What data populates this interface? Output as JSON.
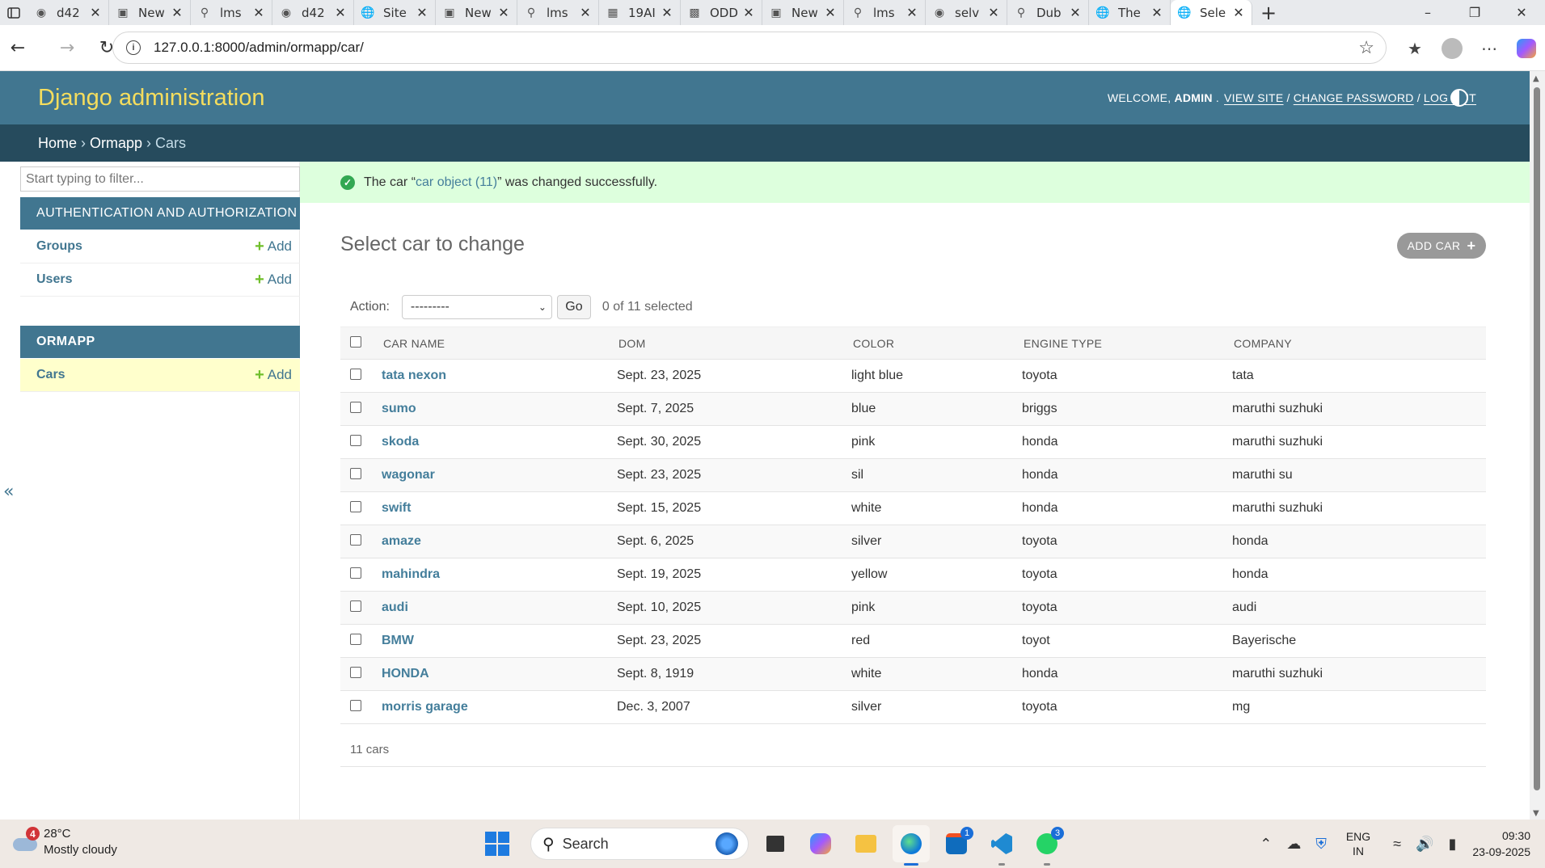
{
  "browser": {
    "tabs": [
      {
        "title": "d42",
        "icon": "github-icon"
      },
      {
        "title": "New",
        "icon": "page-icon"
      },
      {
        "title": "lms",
        "icon": "search-icon"
      },
      {
        "title": "d42",
        "icon": "github-icon"
      },
      {
        "title": "Site",
        "icon": "globe-icon"
      },
      {
        "title": "New",
        "icon": "page-icon"
      },
      {
        "title": "lms",
        "icon": "search-icon"
      },
      {
        "title": "19AI",
        "icon": "gallery-icon"
      },
      {
        "title": "ODD",
        "icon": "pdf-icon"
      },
      {
        "title": "New",
        "icon": "page-icon"
      },
      {
        "title": "lms",
        "icon": "search-icon"
      },
      {
        "title": "selv",
        "icon": "github-icon"
      },
      {
        "title": "Dub",
        "icon": "search-icon"
      },
      {
        "title": "The",
        "icon": "globe-icon"
      },
      {
        "title": "Sele",
        "icon": "globe-icon",
        "active": true
      }
    ],
    "url": "127.0.0.1:8000/admin/ormapp/car/"
  },
  "header": {
    "branding": "Django administration",
    "welcome": "WELCOME,",
    "username": "ADMIN",
    "period": ".",
    "view_site": "VIEW SITE",
    "change_password": "CHANGE PASSWORD",
    "log_out": "LOG OUT",
    "sep": "/"
  },
  "breadcrumbs": {
    "home": "Home",
    "app": "Ormapp",
    "current": "Cars",
    "sep": "›"
  },
  "sidebar": {
    "filter_placeholder": "Start typing to filter...",
    "apps": [
      {
        "caption": "AUTHENTICATION AND AUTHORIZATION",
        "models": [
          {
            "name": "Groups",
            "add": "Add"
          },
          {
            "name": "Users",
            "add": "Add"
          }
        ]
      },
      {
        "caption": "ORMAPP",
        "models": [
          {
            "name": "Cars",
            "add": "Add"
          }
        ]
      }
    ],
    "collapse": "«"
  },
  "message": {
    "prefix": "The car “",
    "link": "car object (11)",
    "suffix": "” was changed successfully."
  },
  "content": {
    "title": "Select car to change",
    "add_button": "ADD CAR",
    "action_label": "Action:",
    "action_value": "---------",
    "go": "Go",
    "counter": "0 of 11 selected",
    "columns": [
      "CAR NAME",
      "DOM",
      "COLOR",
      "ENGINE TYPE",
      "COMPANY"
    ],
    "rows": [
      [
        "tata nexon",
        "Sept. 23, 2025",
        "light blue",
        "toyota",
        "tata"
      ],
      [
        "sumo",
        "Sept. 7, 2025",
        "blue",
        "briggs",
        "maruthi suzhuki"
      ],
      [
        "skoda",
        "Sept. 30, 2025",
        "pink",
        "honda",
        "maruthi suzhuki"
      ],
      [
        "wagonar",
        "Sept. 23, 2025",
        "sil",
        "honda",
        "maruthi su"
      ],
      [
        "swift",
        "Sept. 15, 2025",
        "white",
        "honda",
        "maruthi suzhuki"
      ],
      [
        "amaze",
        "Sept. 6, 2025",
        "silver",
        "toyota",
        "honda"
      ],
      [
        "mahindra",
        "Sept. 19, 2025",
        "yellow",
        "toyota",
        "honda"
      ],
      [
        "audi",
        "Sept. 10, 2025",
        "pink",
        "toyota",
        "audi"
      ],
      [
        "BMW",
        "Sept. 23, 2025",
        "red",
        "toyot",
        "Bayerische"
      ],
      [
        "HONDA",
        "Sept. 8, 1919",
        "white",
        "honda",
        "maruthi suzhuki"
      ],
      [
        "morris garage",
        "Dec. 3, 2007",
        "silver",
        "toyota",
        "mg"
      ]
    ],
    "paginator": "11 cars"
  },
  "taskbar": {
    "weather_badge": "4",
    "temp": "28°C",
    "condition": "Mostly cloudy",
    "search": "Search",
    "store_badge": "1",
    "whatsapp_badge": "3",
    "lang1": "ENG",
    "lang2": "IN",
    "time": "09:30",
    "date": "23-09-2025"
  },
  "colors": {
    "header": "#417690",
    "breadcrumbs": "#264b5d",
    "branding": "#f5dd5d",
    "success": "#dfd",
    "link": "#447e9b"
  }
}
